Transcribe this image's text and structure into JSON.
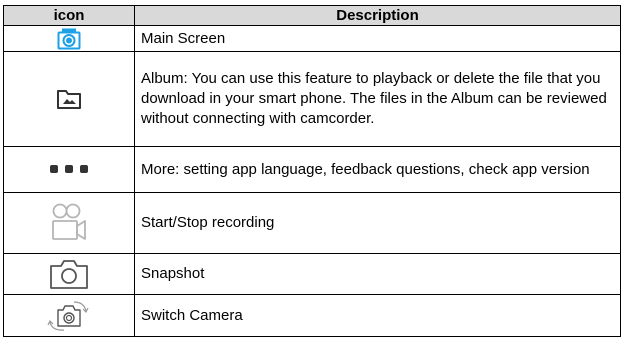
{
  "table": {
    "header": {
      "icon": "icon",
      "description": "Description"
    },
    "rows": [
      {
        "icon": "main-screen-camera-icon",
        "description": "Main Screen"
      },
      {
        "icon": "album-folder-icon",
        "description": "Album: You can use this feature to playback or delete the file that you download in your smart phone. The files in the Album can be reviewed without connecting with camcorder."
      },
      {
        "icon": "more-dots-icon",
        "description": "More: setting app language, feedback questions, check app version"
      },
      {
        "icon": "video-camera-icon",
        "description": "Start/Stop recording"
      },
      {
        "icon": "snapshot-camera-icon",
        "description": "Snapshot"
      },
      {
        "icon": "switch-camera-icon",
        "description": "Switch Camera"
      }
    ]
  },
  "colors": {
    "header_bg": "#d9d9d9",
    "accent_blue": "#1ea0e6",
    "icon_dark": "#333333",
    "icon_light": "#b5b5b5"
  }
}
